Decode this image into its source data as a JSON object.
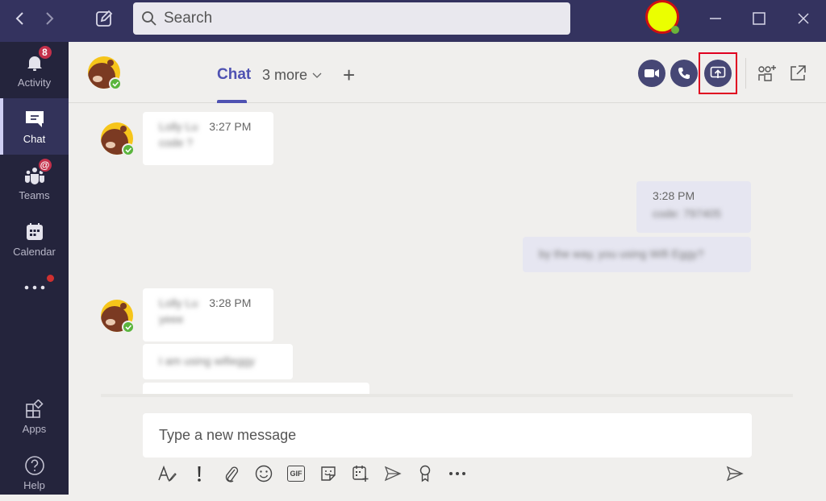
{
  "titlebar": {
    "search_placeholder": "Search",
    "icons": [
      "back-icon",
      "forward-icon",
      "compose-icon",
      "search-icon",
      "minimize-icon",
      "maximize-icon",
      "close-icon"
    ]
  },
  "sidebar": {
    "items": [
      {
        "label": "Activity",
        "icon": "bell-icon",
        "badge": "8"
      },
      {
        "label": "Chat",
        "icon": "chat-icon",
        "active": true
      },
      {
        "label": "Teams",
        "icon": "teams-icon",
        "badge": "@"
      },
      {
        "label": "Calendar",
        "icon": "calendar-icon"
      },
      {
        "label": "More",
        "icon": "more-icon"
      },
      {
        "label": "Apps",
        "icon": "apps-icon"
      },
      {
        "label": "Help",
        "icon": "help-icon"
      }
    ]
  },
  "header": {
    "tab_chat": "Chat",
    "tab_more": "3 more",
    "tab_add": "+",
    "actions": [
      "video-call",
      "audio-call",
      "share-screen",
      "add-people",
      "pop-out"
    ]
  },
  "messages": [
    {
      "sender": "other",
      "name": "(blurred)",
      "time": "3:27 PM",
      "text": "code ?"
    },
    {
      "sender": "me",
      "time": "3:28 PM",
      "text": "code: 797405"
    },
    {
      "sender": "me",
      "text": "by the way, you using Wifi Eggy?"
    },
    {
      "sender": "other",
      "name": "(blurred)",
      "time": "3:28 PM",
      "text": "yeee"
    },
    {
      "sender": "other",
      "text": "I am using wifieggy"
    }
  ],
  "blurred": {
    "name1": "Lolly Lu",
    "name2": "Lolly Lu"
  },
  "compose": {
    "placeholder": "Type a new message"
  },
  "toolbar": {
    "gif_label": "GIF"
  },
  "colors": {
    "titlebar": "#34335f",
    "sidebar": "#24243c",
    "accent": "#4f52b2",
    "call_button": "#464775",
    "highlight": "#e00020"
  }
}
